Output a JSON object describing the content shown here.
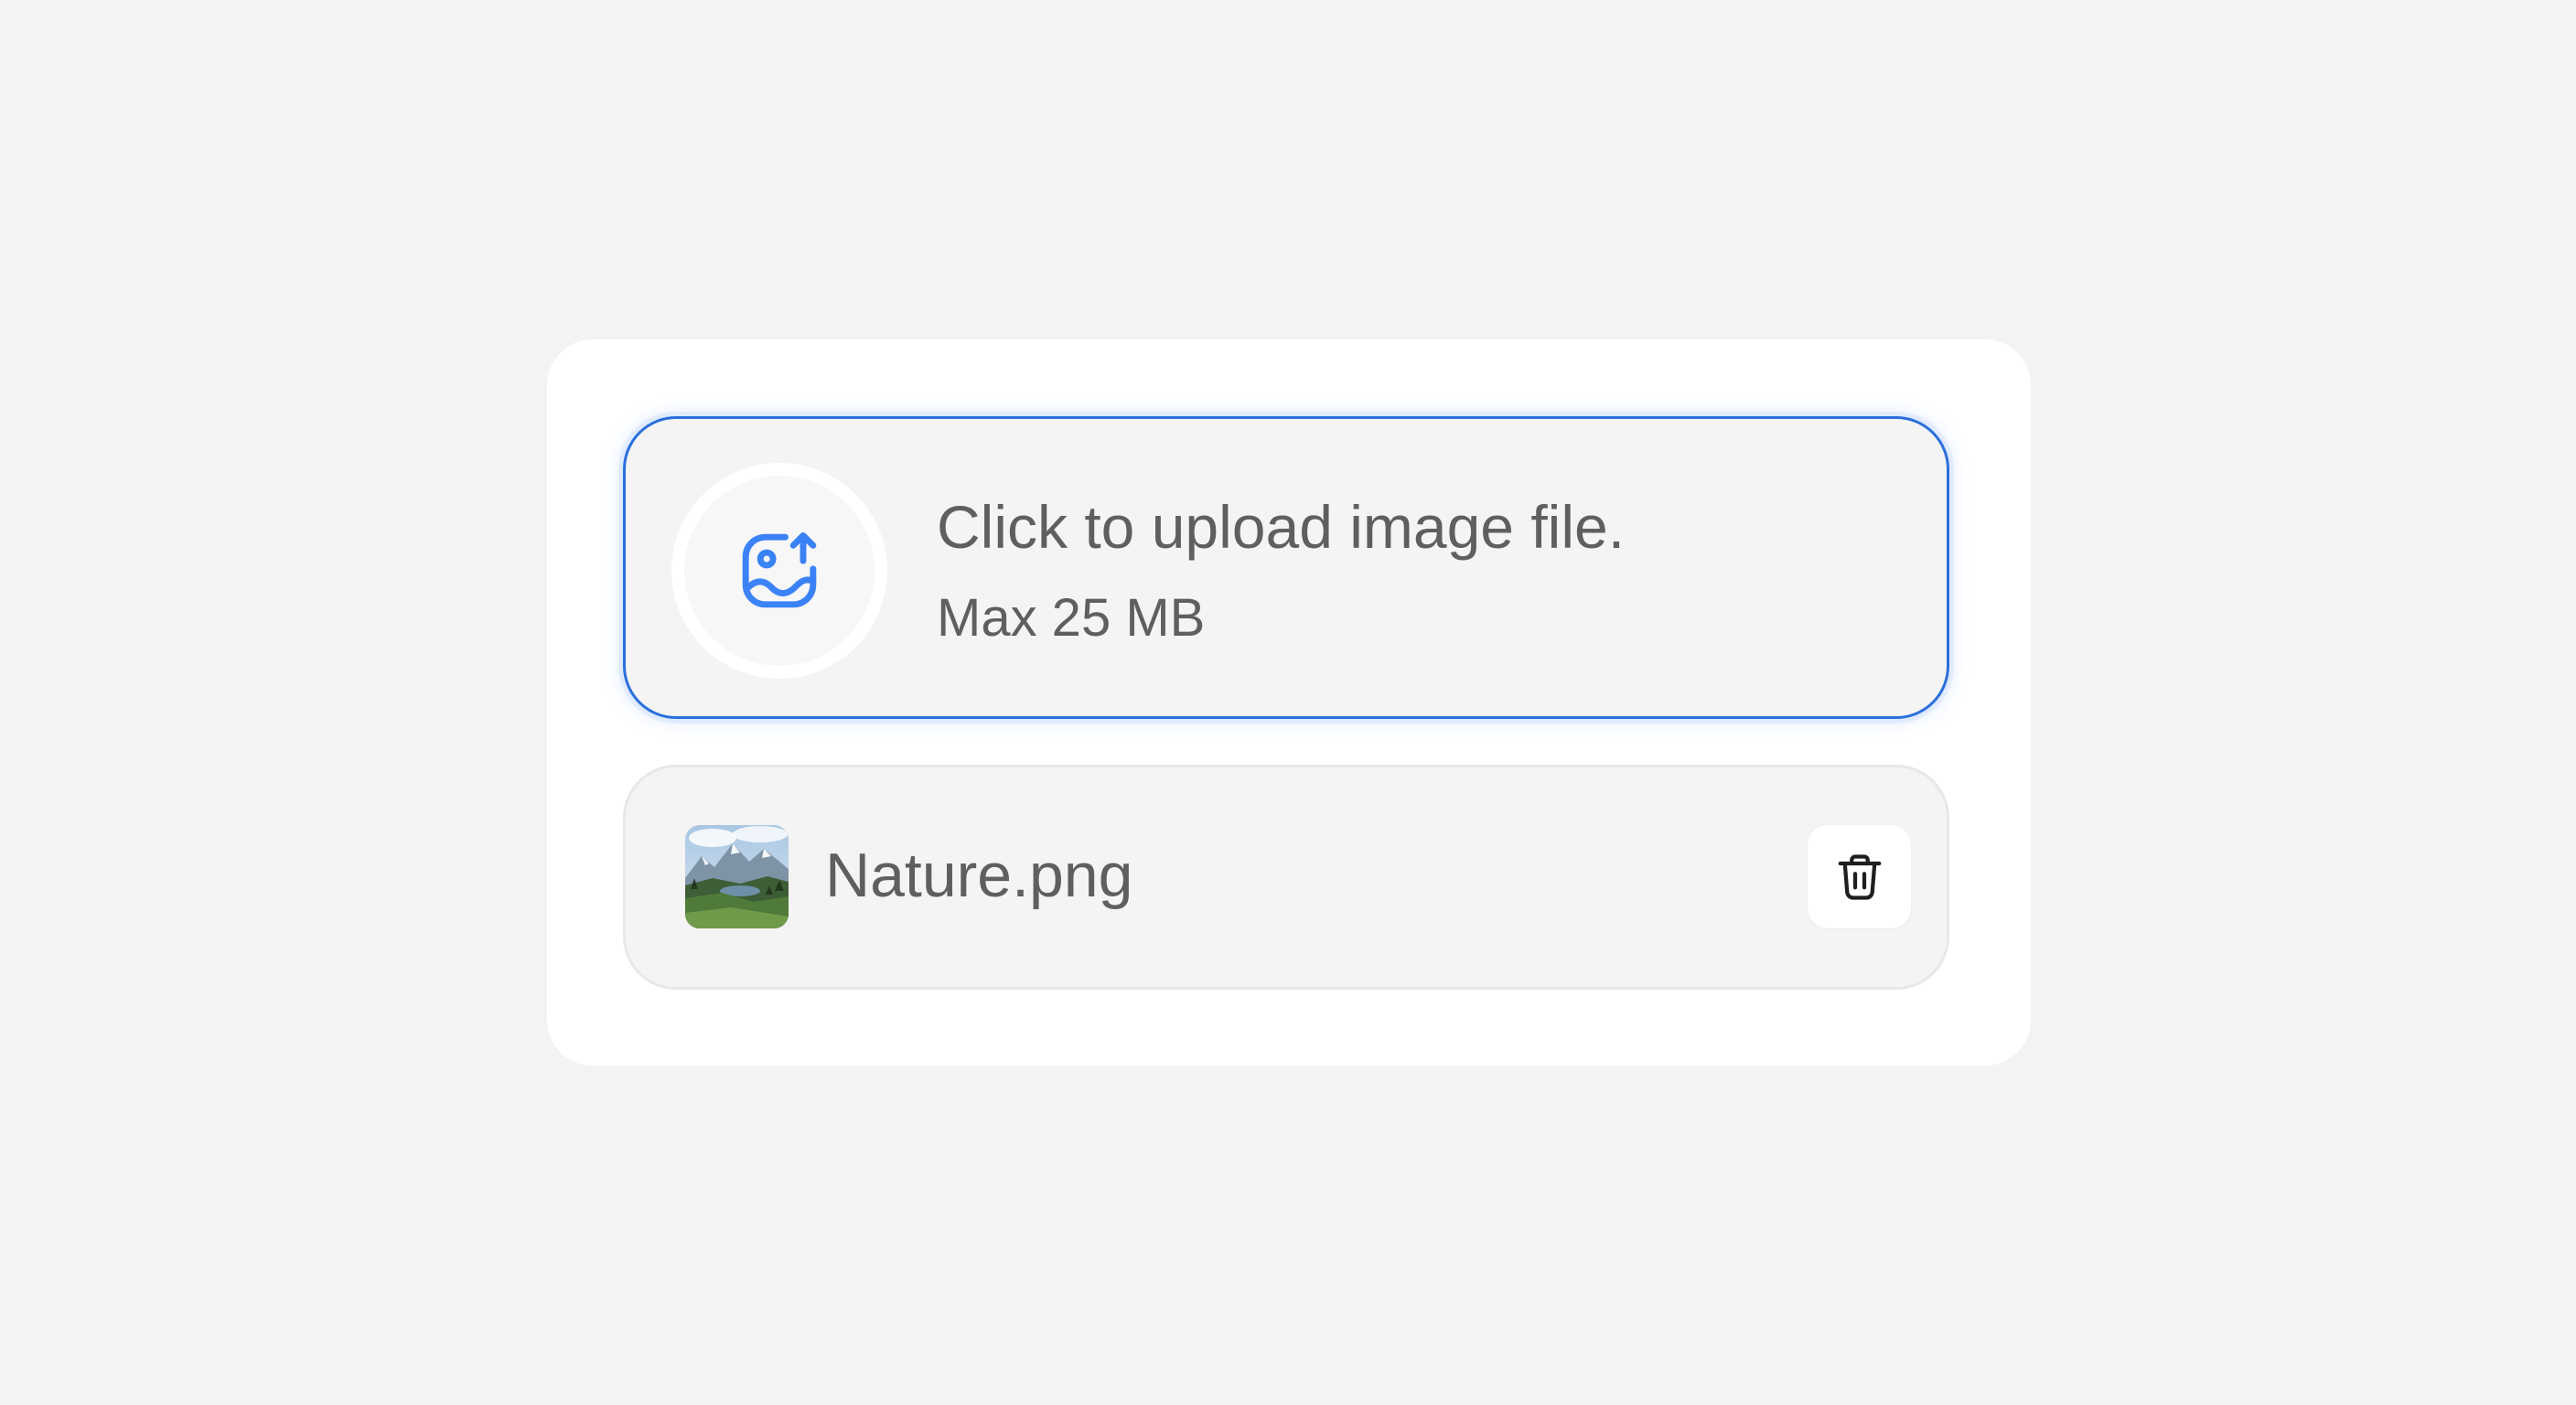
{
  "upload": {
    "title": "Click to upload image file.",
    "subtitle": "Max 25 MB",
    "icon": "image-upload-icon",
    "accent_color": "#2b6fdc"
  },
  "file": {
    "name": "Nature.png",
    "thumbnail": "landscape-thumbnail",
    "delete_icon": "trash-icon"
  }
}
